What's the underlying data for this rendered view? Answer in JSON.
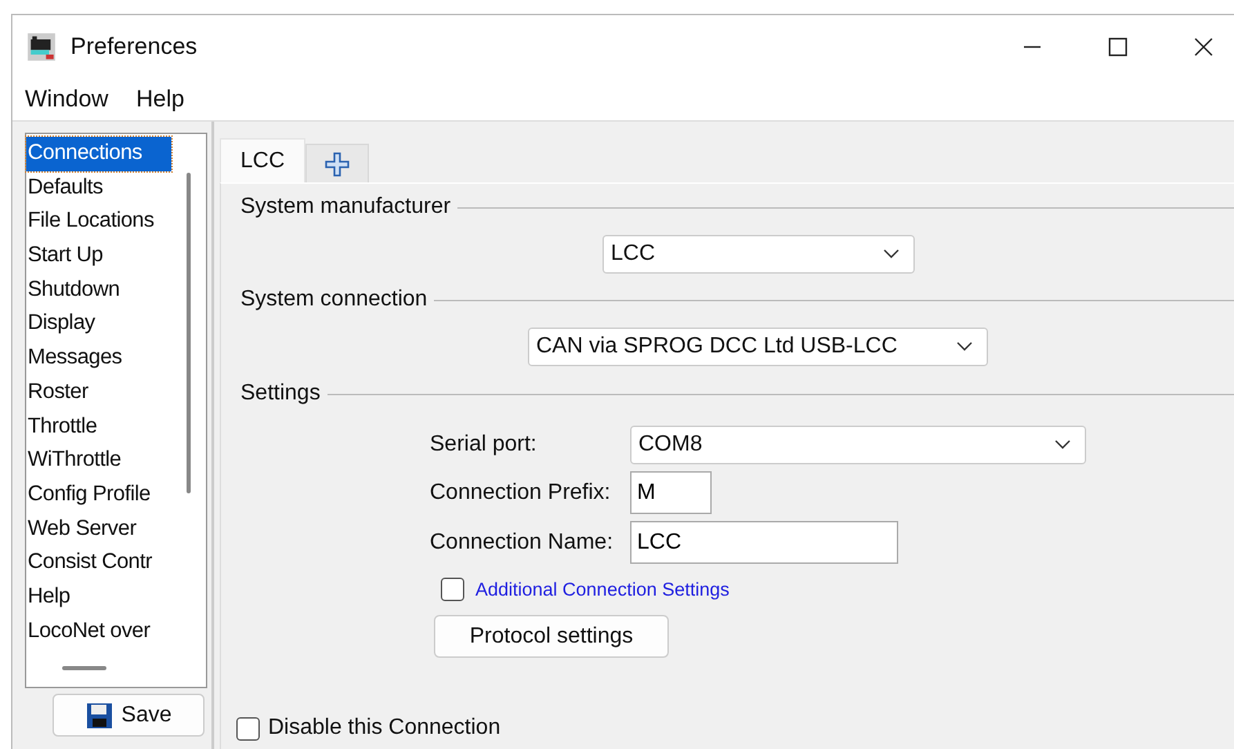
{
  "window": {
    "title": "Preferences"
  },
  "menu": [
    "Window",
    "Help"
  ],
  "sidebar": {
    "items": [
      {
        "label": "Connections",
        "selected": true
      },
      {
        "label": "Defaults",
        "selected": false
      },
      {
        "label": "File Locations",
        "selected": false
      },
      {
        "label": "Start Up",
        "selected": false
      },
      {
        "label": "Shutdown",
        "selected": false
      },
      {
        "label": "Display",
        "selected": false
      },
      {
        "label": "Messages",
        "selected": false
      },
      {
        "label": "Roster",
        "selected": false
      },
      {
        "label": "Throttle",
        "selected": false
      },
      {
        "label": "WiThrottle",
        "selected": false
      },
      {
        "label": "Config Profile",
        "selected": false
      },
      {
        "label": "Web Server",
        "selected": false
      },
      {
        "label": "Consist Contr",
        "selected": false
      },
      {
        "label": "Help",
        "selected": false
      },
      {
        "label": "LocoNet over",
        "selected": false
      }
    ]
  },
  "save_button": "Save",
  "tabs": [
    {
      "label": "LCC",
      "kind": "text",
      "selected": true
    },
    {
      "kind": "add",
      "selected": false
    }
  ],
  "sections": [
    {
      "title": "System manufacturer",
      "combo": "LCC"
    },
    {
      "title": "System connection",
      "combo": "CAN via SPROG DCC Ltd USB-LCC"
    },
    {
      "title": "Settings"
    }
  ],
  "settings": {
    "serial_port": {
      "label": "Serial port:",
      "value": "COM8"
    },
    "prefix": {
      "label": "Connection Prefix:",
      "value": "M"
    },
    "name": {
      "label": "Connection Name:",
      "value": "LCC"
    },
    "additional": {
      "label": "Additional Connection Settings",
      "checked": false
    },
    "protocol_button": "Protocol settings"
  },
  "disable": {
    "label": "Disable this Connection",
    "checked": false
  }
}
